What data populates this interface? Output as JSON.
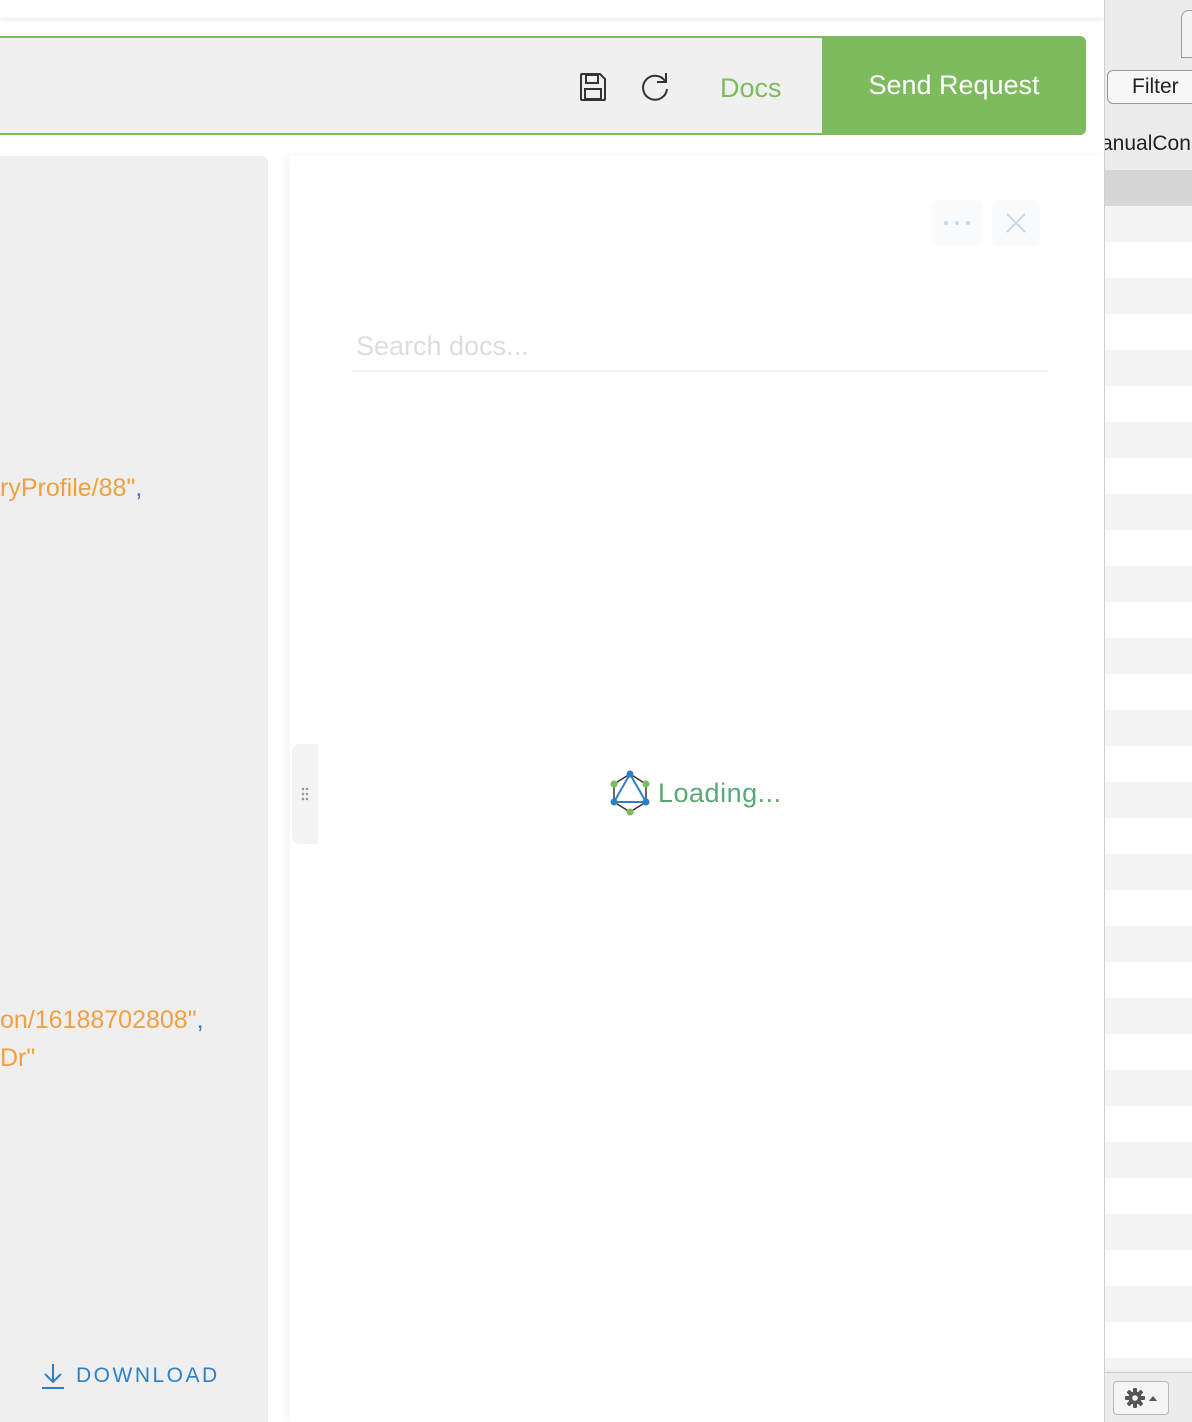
{
  "toolbar": {
    "docs_label": "Docs",
    "send_label": "Send Request",
    "accent_color": "#7dbb5e"
  },
  "result": {
    "lines": [
      {
        "text": "ryProfile/88\"",
        "suffix": ","
      },
      {
        "text": "on/16188702808\"",
        "suffix": ","
      },
      {
        "text": " Dr\"",
        "suffix": ""
      }
    ],
    "download_label": "DOWNLOAD"
  },
  "docs": {
    "search_placeholder": "Search docs...",
    "loading_text": "Loading...",
    "more_icon": "ellipsis-icon",
    "close_icon": "close-icon"
  },
  "side_panel": {
    "filter_label": "Filter",
    "truncated_text": "anualCon",
    "gear_icon": "gear-icon"
  }
}
